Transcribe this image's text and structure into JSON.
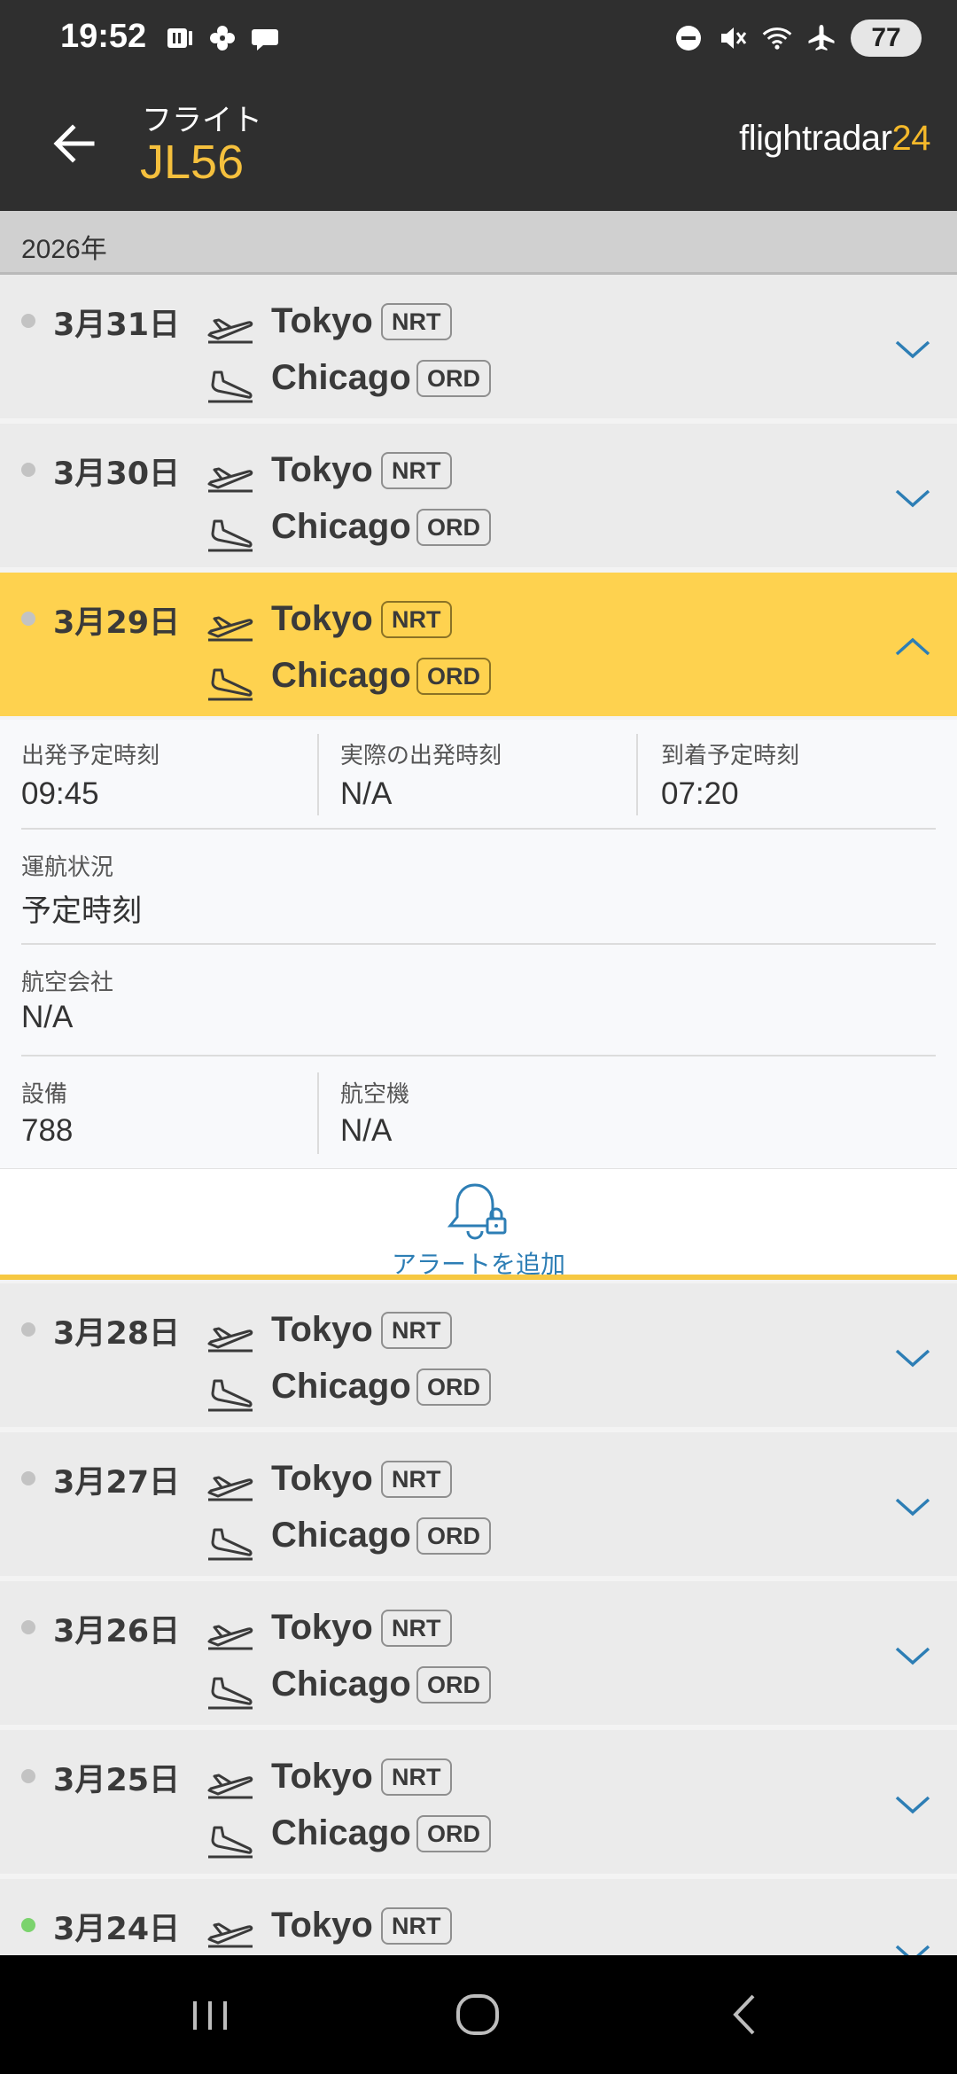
{
  "status_bar": {
    "time": "19:52",
    "battery": "77",
    "left_icons": [
      "media-icon",
      "pinwheel-icon",
      "chat-bubble-icon"
    ],
    "right_icons": [
      "do-not-disturb-icon",
      "mute-icon",
      "wifi-icon",
      "airplane-mode-icon"
    ]
  },
  "header": {
    "label": "フライト",
    "flight_number": "JL56",
    "brand_text": "flightradar",
    "brand_number": "24"
  },
  "year_label": "2026年",
  "flights": [
    {
      "date": "3月31日",
      "dep_city": "Tokyo",
      "dep_code": "NRT",
      "arr_city": "Chicago",
      "arr_code": "ORD",
      "status": "gray"
    },
    {
      "date": "3月30日",
      "dep_city": "Tokyo",
      "dep_code": "NRT",
      "arr_city": "Chicago",
      "arr_code": "ORD",
      "status": "gray"
    },
    {
      "date": "3月29日",
      "dep_city": "Tokyo",
      "dep_code": "NRT",
      "arr_city": "Chicago",
      "arr_code": "ORD",
      "status": "gray",
      "expanded": true
    },
    {
      "date": "3月28日",
      "dep_city": "Tokyo",
      "dep_code": "NRT",
      "arr_city": "Chicago",
      "arr_code": "ORD",
      "status": "gray"
    },
    {
      "date": "3月27日",
      "dep_city": "Tokyo",
      "dep_code": "NRT",
      "arr_city": "Chicago",
      "arr_code": "ORD",
      "status": "gray"
    },
    {
      "date": "3月26日",
      "dep_city": "Tokyo",
      "dep_code": "NRT",
      "arr_city": "Chicago",
      "arr_code": "ORD",
      "status": "gray"
    },
    {
      "date": "3月25日",
      "dep_city": "Tokyo",
      "dep_code": "NRT",
      "arr_city": "Chicago",
      "arr_code": "ORD",
      "status": "gray"
    },
    {
      "date": "3月24日",
      "dep_city": "Tokyo",
      "dep_code": "NRT",
      "status": "green"
    }
  ],
  "details": {
    "sched_dep_label": "出発予定時刻",
    "sched_dep_value": "09:45",
    "actual_dep_label": "実際の出発時刻",
    "actual_dep_value": "N/A",
    "sched_arr_label": "到着予定時刻",
    "sched_arr_value": "07:20",
    "status_label": "運航状況",
    "status_value": "予定時刻",
    "airline_label": "航空会社",
    "airline_value": "N/A",
    "equipment_label": "設備",
    "equipment_value": "788",
    "aircraft_label": "航空機",
    "aircraft_value": "N/A",
    "alert_label": "アラートを追加"
  },
  "colors": {
    "app_bar": "#2f2f2f",
    "accent_yellow": "#fed24f",
    "flight_number": "#f5c03d",
    "link_blue": "#2d7eb5",
    "status_green": "#7bd36d"
  }
}
